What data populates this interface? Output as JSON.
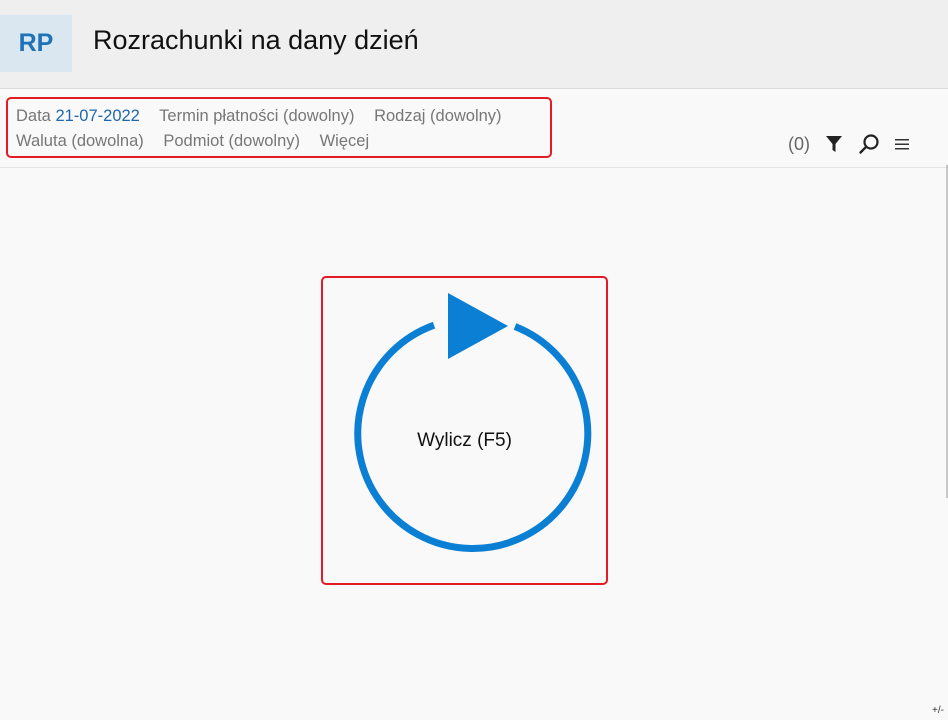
{
  "header": {
    "badge": "RP",
    "title": "Rozrachunki na dany dzień"
  },
  "filters": {
    "date_label": "Data",
    "date_value": "21-07-2022",
    "termin": "Termin płatności (dowolny)",
    "rodzaj": "Rodzaj (dowolny)",
    "waluta": "Waluta (dowolna)",
    "podmiot": "Podmiot (dowolny)",
    "wiecej": "Więcej"
  },
  "toolbar": {
    "count": "(0)",
    "icons": [
      "filter-icon",
      "search-icon",
      "menu-icon"
    ]
  },
  "calculate": {
    "label": "Wylicz (F5)",
    "icon": "refresh-play-icon"
  },
  "corner": {
    "label": "+/-"
  },
  "colors": {
    "accent": "#0a7fd4",
    "highlight": "#e11c24",
    "badge_bg": "#dae7f1",
    "badge_text": "#1e73b8"
  }
}
